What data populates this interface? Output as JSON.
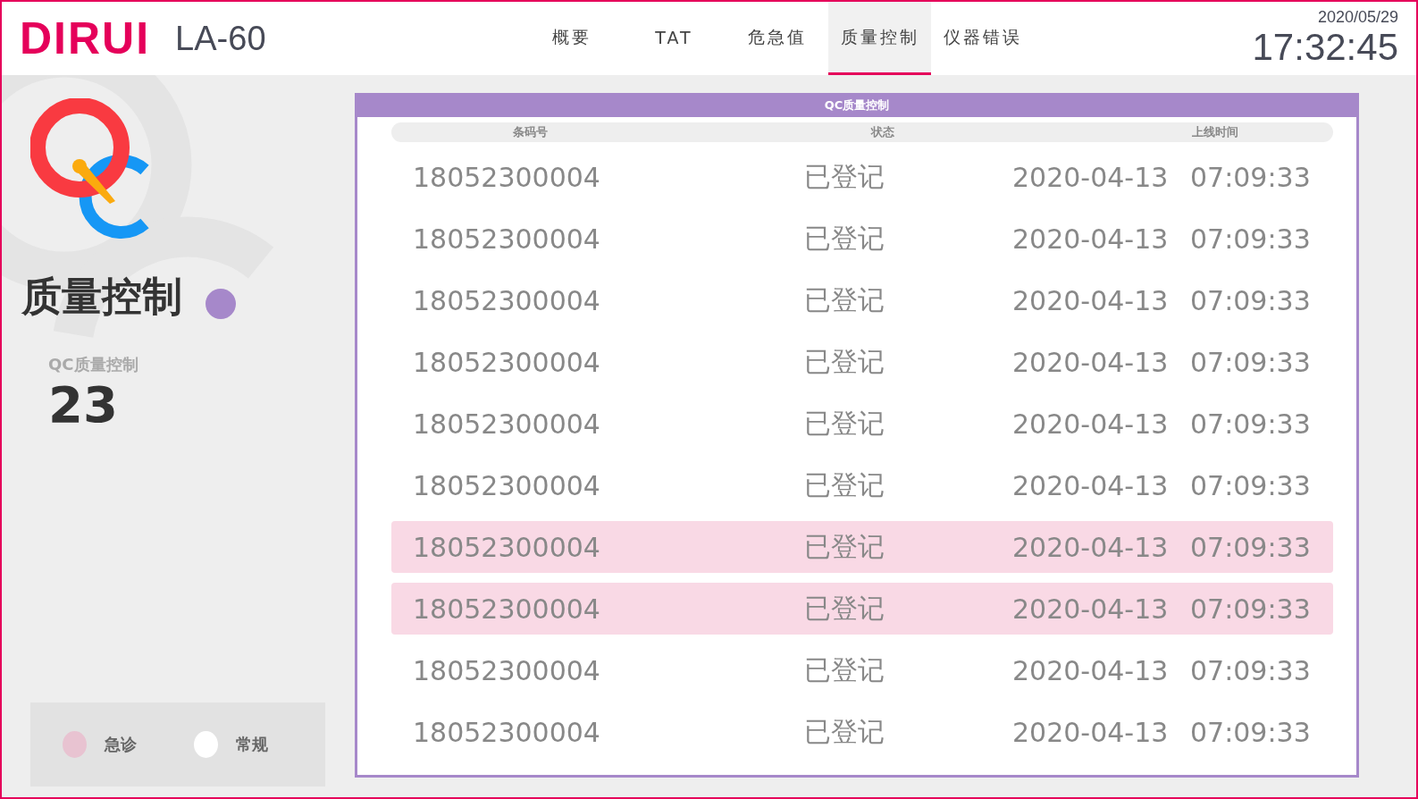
{
  "header": {
    "logo": "DIRUI",
    "model": "LA-60",
    "tabs": [
      {
        "label": "概要",
        "selected": false
      },
      {
        "label": "TAT",
        "selected": false
      },
      {
        "label": "危急值",
        "selected": false
      },
      {
        "label": "质量控制",
        "selected": true
      },
      {
        "label": "仪器错误",
        "selected": false
      }
    ],
    "date": "2020/05/29",
    "time": "17:32:45"
  },
  "side": {
    "title": "质量控制",
    "stat_label": "QC质量控制",
    "stat_value": "23",
    "legend": [
      {
        "label": "急诊",
        "color": "#e8c3d1"
      },
      {
        "label": "常规",
        "color": "#ffffff"
      }
    ]
  },
  "table": {
    "title": "QC质量控制",
    "columns": [
      "条码号",
      "状态",
      "上线时间"
    ],
    "rows": [
      {
        "barcode": "18052300004",
        "status": "已登记",
        "date": "2020-04-13",
        "time": "07:09:33",
        "highlighted": false
      },
      {
        "barcode": "18052300004",
        "status": "已登记",
        "date": "2020-04-13",
        "time": "07:09:33",
        "highlighted": false
      },
      {
        "barcode": "18052300004",
        "status": "已登记",
        "date": "2020-04-13",
        "time": "07:09:33",
        "highlighted": false
      },
      {
        "barcode": "18052300004",
        "status": "已登记",
        "date": "2020-04-13",
        "time": "07:09:33",
        "highlighted": false
      },
      {
        "barcode": "18052300004",
        "status": "已登记",
        "date": "2020-04-13",
        "time": "07:09:33",
        "highlighted": false
      },
      {
        "barcode": "18052300004",
        "status": "已登记",
        "date": "2020-04-13",
        "time": "07:09:33",
        "highlighted": false
      },
      {
        "barcode": "18052300004",
        "status": "已登记",
        "date": "2020-04-13",
        "time": "07:09:33",
        "highlighted": true
      },
      {
        "barcode": "18052300004",
        "status": "已登记",
        "date": "2020-04-13",
        "time": "07:09:33",
        "highlighted": true
      },
      {
        "barcode": "18052300004",
        "status": "已登记",
        "date": "2020-04-13",
        "time": "07:09:33",
        "highlighted": false
      },
      {
        "barcode": "18052300004",
        "status": "已登记",
        "date": "2020-04-13",
        "time": "07:09:33",
        "highlighted": false
      }
    ]
  }
}
